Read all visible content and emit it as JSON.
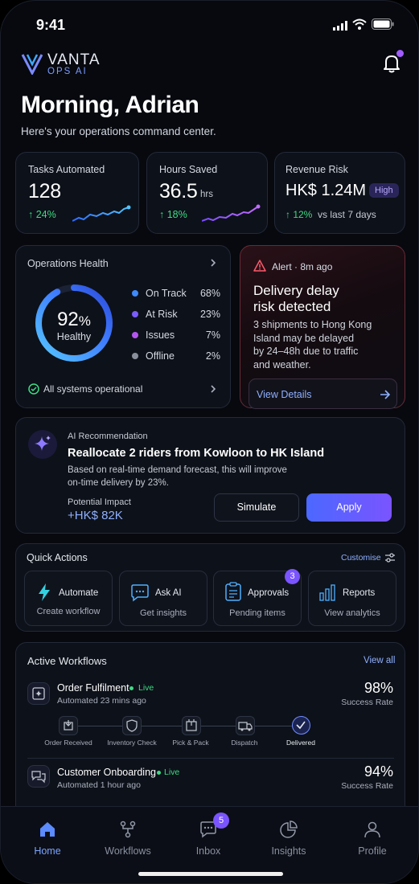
{
  "status_bar": {
    "time": "9:41"
  },
  "brand": {
    "name": "VANTA",
    "sub": "OPS AI"
  },
  "greeting": {
    "title": "Morning, Adrian",
    "subtitle": "Here's your operations command center."
  },
  "kpis": [
    {
      "label": "Tasks Automated",
      "value": "128",
      "unit": "",
      "delta": "↑ 24%",
      "delta_note": ""
    },
    {
      "label": "Hours Saved",
      "value": "36.5",
      "unit": "hrs",
      "delta": "↑ 18%",
      "delta_note": ""
    },
    {
      "label": "Revenue Risk",
      "value": "HK$ 1.24M",
      "unit": "",
      "badge": "High",
      "delta": "↑ 12%",
      "delta_note": "vs last 7 days"
    }
  ],
  "ops_health": {
    "title": "Operations Health",
    "percent": "92",
    "percent_sign": "%",
    "status": "Healthy",
    "legend": [
      {
        "label": "On Track",
        "value": "68%",
        "color": "#3d8bff"
      },
      {
        "label": "At Risk",
        "value": "23%",
        "color": "#7a5cff"
      },
      {
        "label": "Issues",
        "value": "7%",
        "color": "#b455f0"
      },
      {
        "label": "Offline",
        "value": "2%",
        "color": "#8a8f9c"
      }
    ],
    "footer": "All systems operational"
  },
  "alert": {
    "meta": "Alert · 8m ago",
    "title_line1": "Delivery delay",
    "title_line2": "risk detected",
    "body_lines": [
      "3 shipments to Hong Kong",
      "Island may be delayed",
      "by 24–48h due to traffic",
      "and weather."
    ],
    "cta": "View Details"
  },
  "ai_rec": {
    "eyebrow": "AI Recommendation",
    "title": "Reallocate 2 riders from Kowloon to HK Island",
    "body_lines": [
      "Based on real-time demand forecast, this will improve",
      "on-time delivery by 23%."
    ],
    "impact_label": "Potential Impact",
    "impact_value": "+HK$ 82K",
    "simulate": "Simulate",
    "apply": "Apply"
  },
  "quick_actions": {
    "title": "Quick Actions",
    "customise": "Customise",
    "items": [
      {
        "title": "Automate",
        "sub": "Create workflow",
        "icon": "lightning-icon"
      },
      {
        "title": "Ask AI",
        "sub": "Get insights",
        "icon": "ai-chat-icon"
      },
      {
        "title": "Approvals",
        "sub": "Pending items",
        "icon": "clipboard-icon",
        "badge": "3"
      },
      {
        "title": "Reports",
        "sub": "View analytics",
        "icon": "bar-chart-icon"
      }
    ]
  },
  "workflows": {
    "title": "Active Workflows",
    "view_all": "View all",
    "items": [
      {
        "name": "Order Fulfilment",
        "live": "Live",
        "meta": "Automated 23 mins ago",
        "rate": "98%",
        "rate_label": "Success Rate",
        "steps": [
          "Order Received",
          "Inventory Check",
          "Pick & Pack",
          "Dispatch",
          "Delivered"
        ]
      },
      {
        "name": "Customer Onboarding",
        "live": "Live",
        "meta": "Automated 1 hour ago",
        "rate": "94%",
        "rate_label": "Success Rate"
      }
    ]
  },
  "tabbar": {
    "items": [
      {
        "label": "Home",
        "active": true
      },
      {
        "label": "Workflows"
      },
      {
        "label": "Inbox",
        "badge": "5"
      },
      {
        "label": "Insights"
      },
      {
        "label": "Profile"
      }
    ]
  },
  "colors": {
    "accent": "#5b63ff",
    "positive": "#3ddc84",
    "alert": "#ff5a6a",
    "background": "#07090f"
  }
}
